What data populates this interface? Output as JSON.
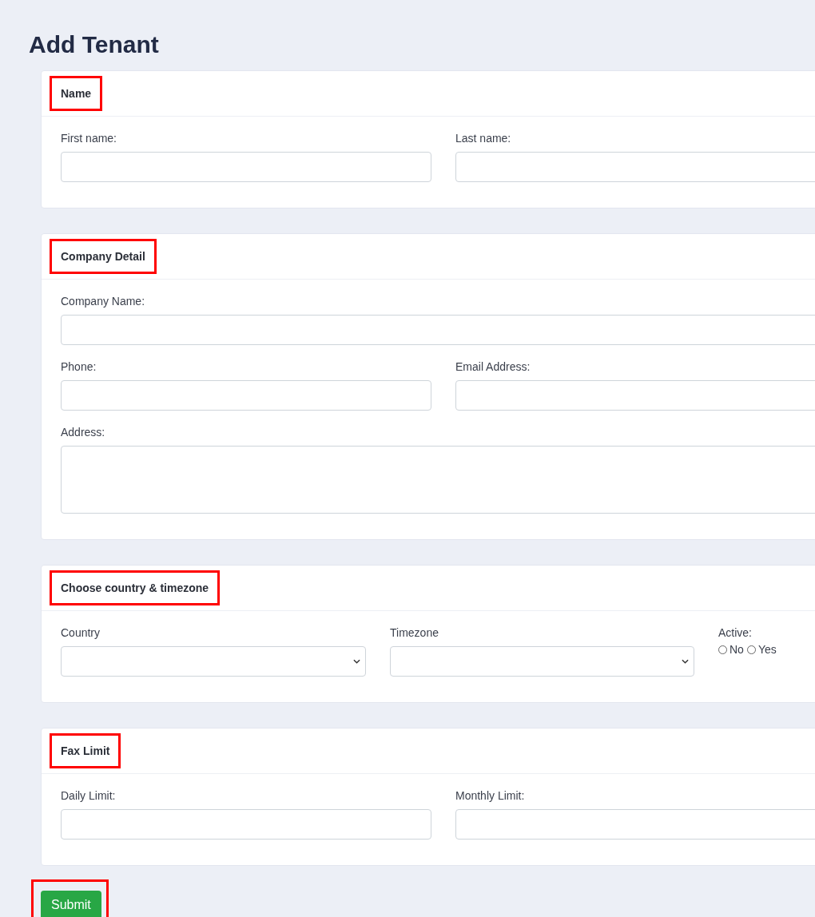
{
  "page_title": "Add Tenant",
  "sections": [
    {
      "title": "Name",
      "highlighted": true,
      "rows": [
        {
          "fields": [
            {
              "kind": "text",
              "label": "First name:"
            },
            {
              "kind": "text",
              "label": "Last name:"
            }
          ]
        }
      ]
    },
    {
      "title": "Company Detail",
      "highlighted": true,
      "rows": [
        {
          "fields": [
            {
              "kind": "text",
              "label": "Company Name:"
            }
          ]
        },
        {
          "fields": [
            {
              "kind": "text",
              "label": "Phone:"
            },
            {
              "kind": "text",
              "label": "Email Address:"
            }
          ]
        },
        {
          "fields": [
            {
              "kind": "textarea",
              "label": "Address:"
            }
          ]
        }
      ]
    },
    {
      "title": "Choose country & timezone",
      "highlighted": true,
      "rows": [
        {
          "fields": [
            {
              "kind": "select",
              "label": "Country"
            },
            {
              "kind": "select",
              "label": "Timezone"
            },
            {
              "kind": "radio",
              "label": "Active:",
              "options": [
                {
                  "label": "No",
                  "selected": false
                },
                {
                  "label": "Yes",
                  "selected": false
                }
              ]
            }
          ]
        }
      ]
    },
    {
      "title": "Fax Limit",
      "highlighted": true,
      "rows": [
        {
          "fields": [
            {
              "kind": "text",
              "label": "Daily Limit:"
            },
            {
              "kind": "text",
              "label": "Monthly Limit:"
            }
          ]
        }
      ]
    }
  ],
  "submit": {
    "label": "Submit",
    "highlighted": true
  }
}
